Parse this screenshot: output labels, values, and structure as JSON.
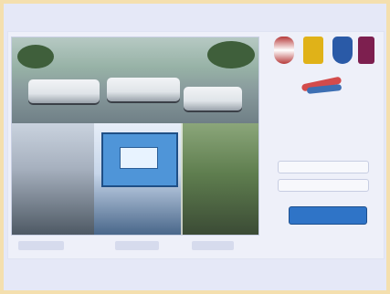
{
  "panel": {
    "title": "",
    "username_placeholder": "",
    "password_placeholder": "",
    "login_label": "",
    "link_primary": "",
    "link_secondary": ""
  },
  "icons": [
    "shield-logo",
    "emblem-logo",
    "crest-logo",
    "badge-logo",
    "swoosh-emblem"
  ],
  "colors": {
    "accent": "#2f74c7",
    "border": "#f4dfae",
    "background": "#e5e8f7"
  }
}
